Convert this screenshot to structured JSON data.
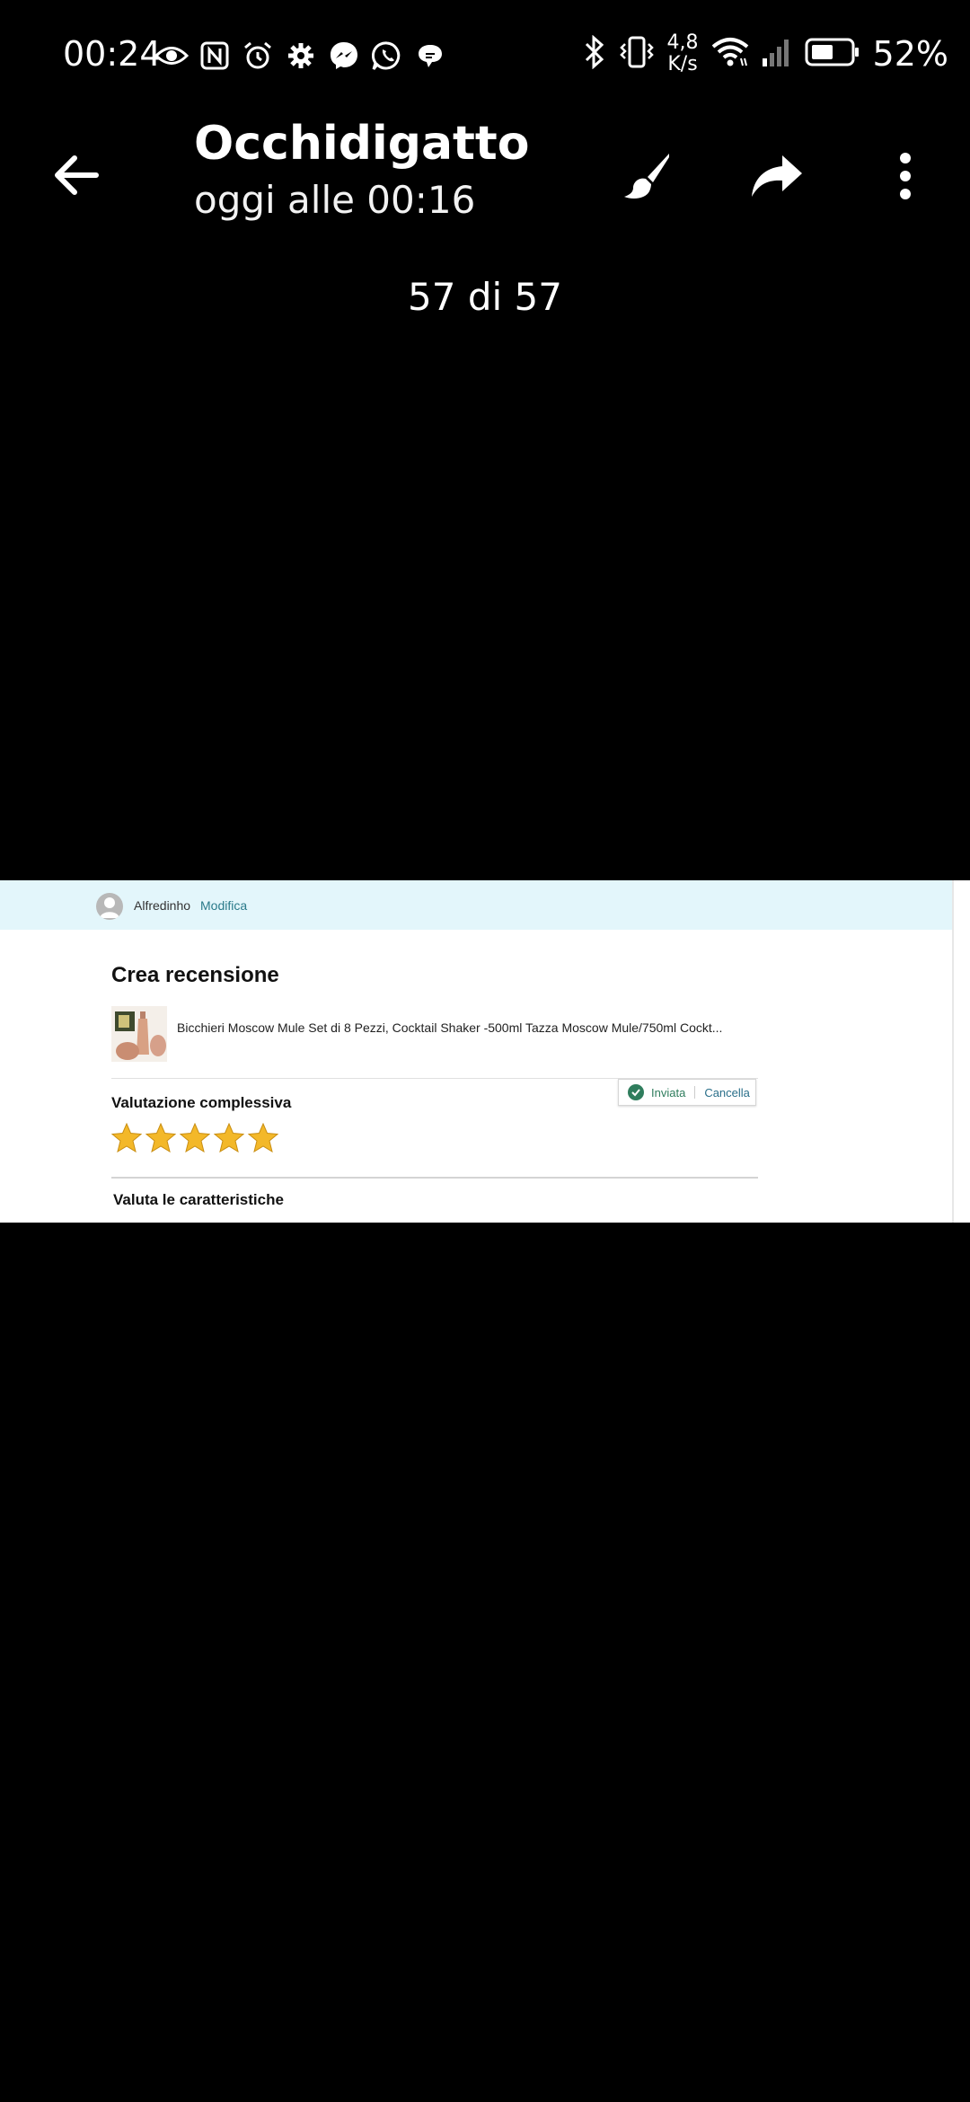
{
  "status_bar": {
    "time": "00:24",
    "network_speed_value": "4,8",
    "network_speed_unit": "K/s",
    "battery_percent": "52%",
    "icons_left": [
      "eye-icon",
      "nfc-icon",
      "alarm-icon",
      "settings-gear-icon",
      "messenger-icon",
      "whatsapp-icon",
      "chat-bubble-icon"
    ],
    "icons_right": [
      "bluetooth-icon",
      "vibrate-icon",
      "wifi-icon",
      "signal-icon",
      "battery-icon"
    ]
  },
  "app_bar": {
    "title": "Occhidigatto",
    "subtitle": "oggi alle 00:16"
  },
  "viewer": {
    "counter": "57 di 57"
  },
  "photo": {
    "username": "Alfredinho",
    "edit_link": "Modifica",
    "heading": "Crea recensione",
    "product_title": "Bicchieri Moscow Mule Set di 8 Pezzi, Cocktail Shaker -500ml Tazza Moscow Mule/750ml Cockt...",
    "submitted_label": "Inviata",
    "cancel_label": "Cancella",
    "overall_rating_label": "Valutazione complessiva",
    "rating": 5,
    "rating_max": 5,
    "features_label": "Valuta le caratteristiche",
    "star_color": "#f3b829"
  }
}
